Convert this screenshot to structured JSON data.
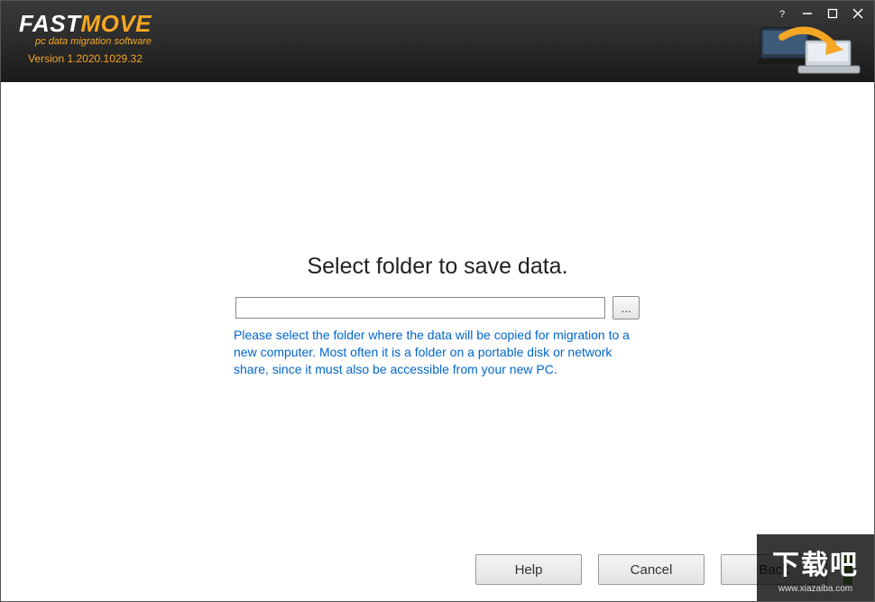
{
  "brand": {
    "name_part1": "FAST",
    "name_part2": "MOVE",
    "tagline": "pc data migration software",
    "version": "Version 1.2020.1029.32"
  },
  "main": {
    "heading": "Select folder to save data.",
    "folder_value": "",
    "browse_label": "...",
    "hint": "Please select the folder where the data will be copied for migration to a new computer. Most often it is a folder on a portable disk or network share, since it must also be accessible from your new PC."
  },
  "footer": {
    "help": "Help",
    "cancel": "Cancel",
    "back": "Back"
  },
  "watermark": {
    "text": "下载吧",
    "url": "www.xiazaiba.com"
  }
}
